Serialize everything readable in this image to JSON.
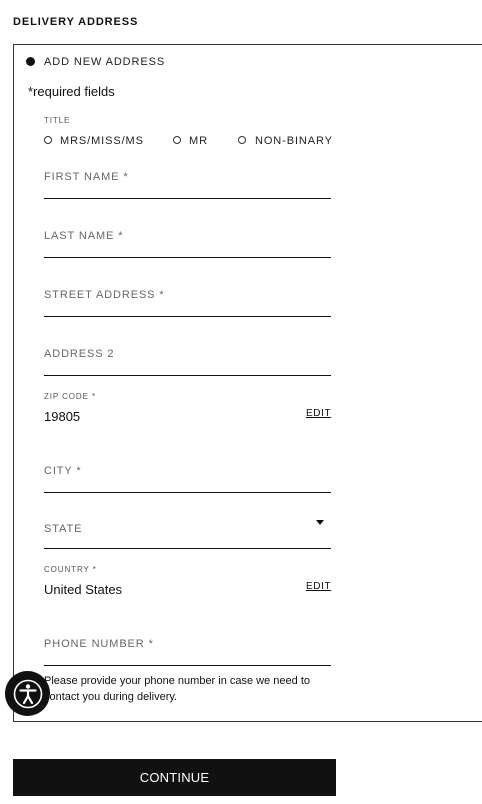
{
  "section_title": "DELIVERY ADDRESS",
  "option_label": "ADD NEW ADDRESS",
  "required_note": "*required fields",
  "title_label": "TITLE",
  "title_options": [
    "MRS/MISS/MS",
    "MR",
    "NON-BINARY"
  ],
  "fields": {
    "first_name": "FIRST NAME *",
    "last_name": "LAST NAME *",
    "street": "STREET ADDRESS *",
    "address2": "ADDRESS 2",
    "zip_label": "ZIP CODE *",
    "zip_value": "19805",
    "city": "CITY *",
    "state": "STATE",
    "country_label": "COUNTRY *",
    "country_value": "United States",
    "phone": "PHONE NUMBER *"
  },
  "edit_label": "EDIT",
  "phone_help": "Please provide your phone number in case we need to contact you during delivery.",
  "continue_label": "CONTINUE",
  "icons": [
    "radio-selected-icon",
    "radio-icon",
    "chevron-down-icon",
    "accessibility-icon"
  ]
}
